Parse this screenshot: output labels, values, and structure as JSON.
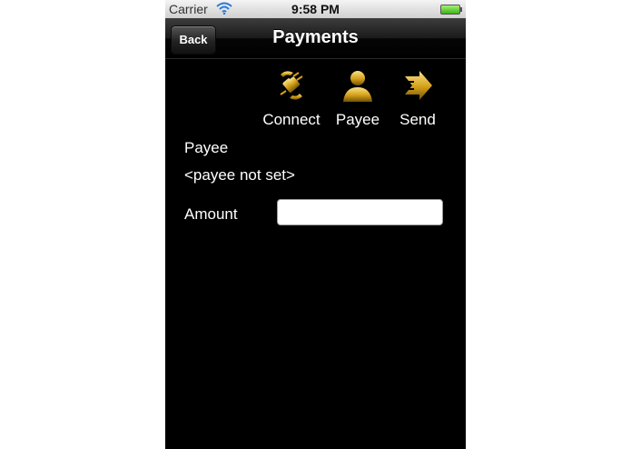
{
  "status_bar": {
    "carrier": "Carrier",
    "time": "9:58 PM",
    "wifi_icon": "wifi-icon",
    "battery_icon": "battery-icon",
    "battery_color": "#39b515"
  },
  "nav": {
    "back_label": "Back",
    "title": "Payments"
  },
  "toolbar": {
    "items": [
      {
        "label": "Connect",
        "icon": "plug-connect-icon"
      },
      {
        "label": "Payee",
        "icon": "person-icon"
      },
      {
        "label": "Send",
        "icon": "arrow-send-icon"
      }
    ],
    "icon_color": "#d4a017"
  },
  "form": {
    "payee_label": "Payee",
    "payee_value": "<payee not set>",
    "amount_label": "Amount",
    "amount_value": ""
  }
}
